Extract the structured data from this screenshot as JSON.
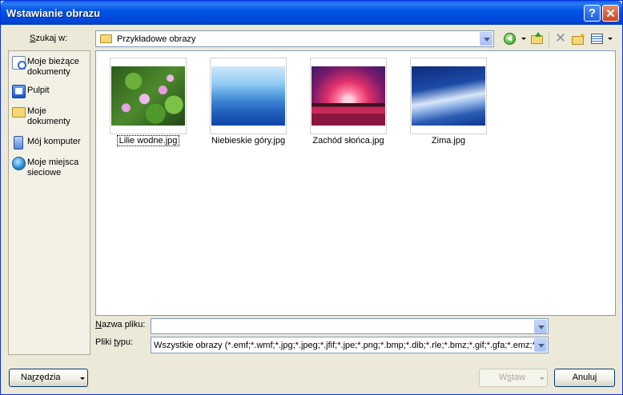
{
  "window": {
    "title": "Wstawianie obrazu",
    "help_button": "?",
    "close_button": "✕"
  },
  "lookin": {
    "label_prefix": "S",
    "label_rest": "zukaj w:",
    "value": "Przykładowe obrazy"
  },
  "toolbar": {
    "icons": [
      "back-icon",
      "up-folder-icon",
      "delete-icon",
      "new-folder-icon",
      "views-icon"
    ]
  },
  "places": [
    {
      "label": "Moje bieżące dokumenty",
      "icon": "recent-documents-icon"
    },
    {
      "label": "Pulpit",
      "icon": "desktop-icon"
    },
    {
      "label": "Moje dokumenty",
      "icon": "my-documents-icon"
    },
    {
      "label": "Mój komputer",
      "icon": "my-computer-icon"
    },
    {
      "label": "Moje miejsca sieciowe",
      "icon": "network-places-icon"
    }
  ],
  "files": [
    {
      "name": "Lilie wodne.jpg",
      "selected": true
    },
    {
      "name": "Niebieskie góry.jpg",
      "selected": false
    },
    {
      "name": "Zachód słońca.jpg",
      "selected": false
    },
    {
      "name": "Zima.jpg",
      "selected": false
    }
  ],
  "filename": {
    "label_prefix": "N",
    "label_rest": "azwa pliku:",
    "value": ""
  },
  "filetype": {
    "label_pre": "Pliki ",
    "label_underlined": "t",
    "label_post": "ypu:",
    "value": "Wszystkie obrazy (*.emf;*.wmf;*.jpg;*.jpeg;*.jfif;*.jpe;*.png;*.bmp;*.dib;*.rle;*.bmz;*.gif;*.gfa;*.emz;*.wmz;*.pcz;*.tif;*.tiff)"
  },
  "buttons": {
    "tools_pre": "Na",
    "tools_underlined": "r",
    "tools_post": "zędzia",
    "insert_pre": "W",
    "insert_underlined": "s",
    "insert_post": "taw",
    "cancel": "Anuluj"
  }
}
